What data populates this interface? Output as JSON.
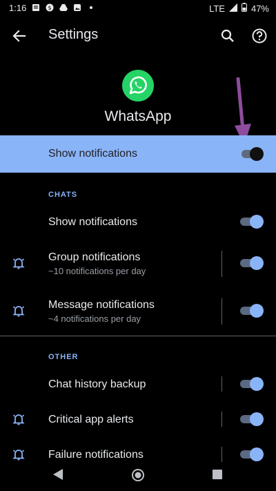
{
  "status_bar": {
    "time": "1:16",
    "left_icons": [
      "message-icon",
      "dollar-icon",
      "drive-icon",
      "photos-icon",
      "dot-icon"
    ],
    "network": "LTE",
    "battery": "47%"
  },
  "app_bar": {
    "title": "Settings",
    "back_icon": "arrow-back-icon",
    "actions": [
      "search-icon",
      "help-icon"
    ]
  },
  "app": {
    "name": "WhatsApp",
    "icon": "whatsapp-logo",
    "brand_color": "#25d366"
  },
  "master_toggle": {
    "label": "Show notifications",
    "enabled": true,
    "background": "#8ab4f8"
  },
  "sections": {
    "chats": {
      "title": "CHATS",
      "items": [
        {
          "title": "Show notifications",
          "subtitle": "",
          "enabled": true,
          "icon": ""
        },
        {
          "title": "Group notifications",
          "subtitle": "~10 notifications per day",
          "enabled": true,
          "icon": "bell-icon"
        },
        {
          "title": "Message notifications",
          "subtitle": "~4 notifications per day",
          "enabled": true,
          "icon": "bell-icon"
        }
      ]
    },
    "other": {
      "title": "OTHER",
      "items": [
        {
          "title": "Chat history backup",
          "enabled": true,
          "icon": ""
        },
        {
          "title": "Critical app alerts",
          "enabled": true,
          "icon": "bell-icon"
        },
        {
          "title": "Failure notifications",
          "enabled": true,
          "icon": "bell-icon"
        }
      ]
    }
  },
  "accent_color": "#8ab4f8",
  "annotation": {
    "type": "arrow",
    "color": "#8e4c9e",
    "points_to": "master-toggle"
  },
  "nav_bar": [
    "back-triangle-icon",
    "home-circle-icon",
    "recents-square-icon"
  ]
}
